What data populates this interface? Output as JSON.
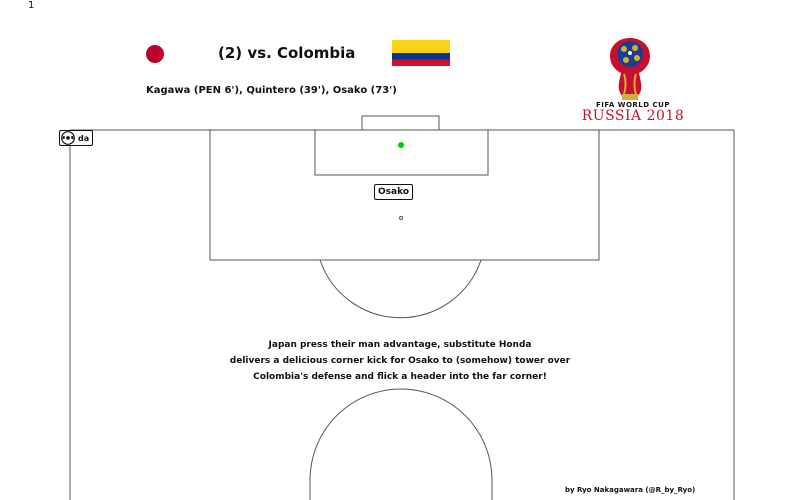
{
  "frame_number": "1",
  "header": {
    "title": "(2) vs. Colombia",
    "scorers": "Kagawa (PEN 6'), Quintero (39'), Osako (73')"
  },
  "flags": {
    "japan": {
      "bg": "#ffffff",
      "disc": "#bc002d"
    },
    "colombia": {
      "yellow": "#fcd116",
      "blue": "#003893",
      "red": "#ce1126"
    }
  },
  "logo": {
    "sub_text": "FIFA WORLD CUP",
    "main_text": "RUSSIA 2018",
    "accent_color": "#c8102e"
  },
  "player_tag": {
    "icon": "soccer-ball-icon",
    "text": "da"
  },
  "scorer_label": "Osako",
  "ball_marker_color": "#00cc00",
  "description": {
    "line1": "Japan press their man advantage, substitute Honda",
    "line2": "delivers a delicious corner kick for Osako to (somehow) tower over",
    "line3": "Colombia's defense and flick a header into the far corner!"
  },
  "credit": "by Ryo Nakagawara (@R_by_Ryo)"
}
